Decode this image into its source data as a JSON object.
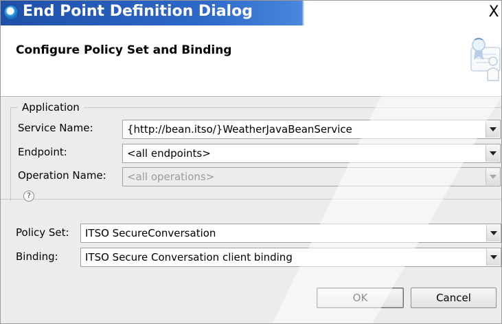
{
  "window": {
    "title": "End Point Definition Dialog",
    "close_glyph": "X",
    "title_icon": "eclipse-dialog-icon"
  },
  "header": {
    "title": "Configure Policy Set and Binding",
    "icon": "certificate-user-icon"
  },
  "application_group": {
    "legend": "Application",
    "service_name": {
      "label": "Service Name:",
      "value": "{http://bean.itso/}WeatherJavaBeanService"
    },
    "endpoint": {
      "label": "Endpoint:",
      "value": "<all endpoints>"
    },
    "operation_name": {
      "label": "Operation Name:",
      "value": "<all operations>",
      "disabled": true
    }
  },
  "policy": {
    "policy_set": {
      "label": "Policy Set:",
      "value": "ITSO SecureConversation"
    },
    "binding": {
      "label": "Binding:",
      "value": "ITSO Secure Conversation client binding"
    }
  },
  "footer": {
    "help_glyph": "?",
    "ok_label": "OK",
    "cancel_label": "Cancel"
  },
  "colors": {
    "title_gradient_start": "#1f4fa8",
    "title_gradient_end": "#4a86dc",
    "content_background": "#ececec"
  }
}
